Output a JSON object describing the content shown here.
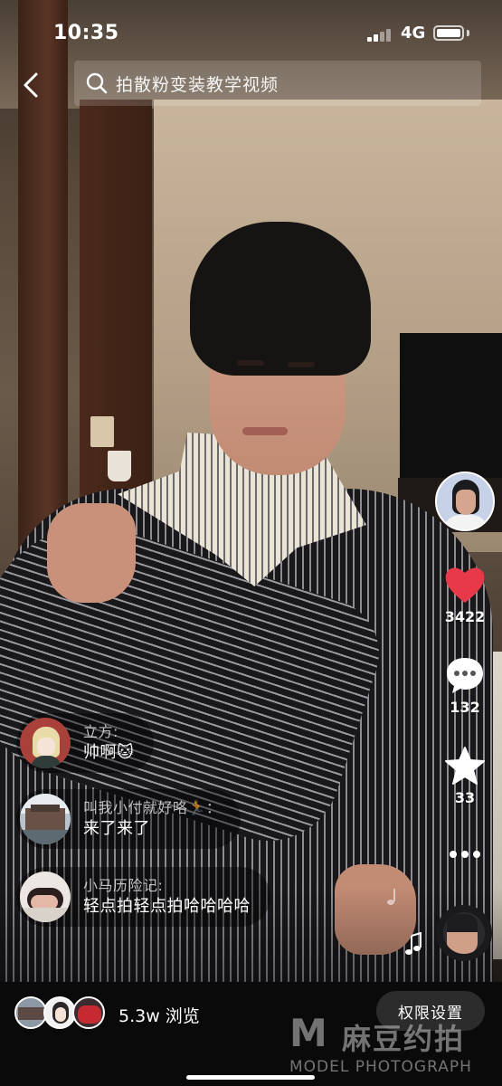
{
  "status_bar": {
    "time": "10:35",
    "network": "4G",
    "battery_level": 1.0
  },
  "header": {
    "back_icon": "chevron-left-icon",
    "search_icon": "search-icon",
    "search_text": "拍散粉变装教学视频"
  },
  "right_rail": {
    "like_icon": "heart-icon",
    "like_color": "#e8394a",
    "like_count": "3422",
    "comment_icon": "chat-bubble-icon",
    "comment_count": "132",
    "favorite_icon": "star-icon",
    "favorite_count": "33",
    "more_icon": "more-dots-icon"
  },
  "comments": [
    {
      "user": "立方:",
      "text": "帅啊🐱"
    },
    {
      "user": "叫我小付就好咯🏃：",
      "text": "来了来了"
    },
    {
      "user": "小马历险记:",
      "text": "轻点拍轻点拍哈哈哈哈"
    }
  ],
  "bottom_bar": {
    "views": "5.3w 浏览",
    "permission_button": "权限设置"
  },
  "watermark": {
    "logo": "M",
    "chinese": "麻豆约拍",
    "english": "MODEL PHOTOGRAPH"
  }
}
